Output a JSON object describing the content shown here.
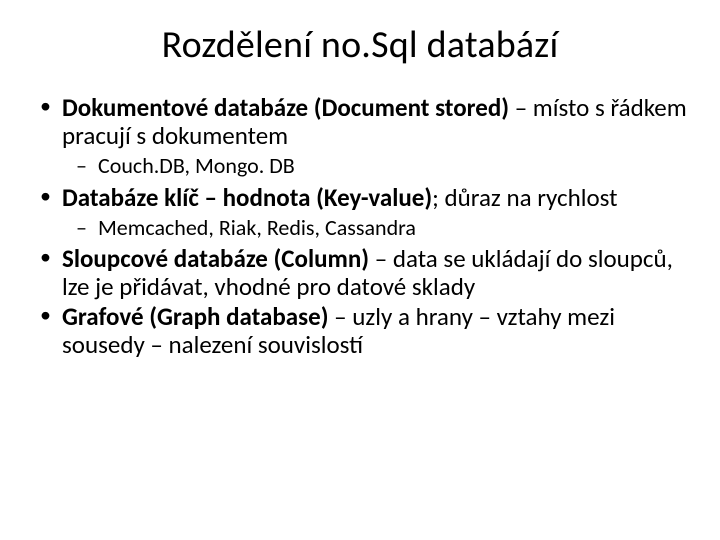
{
  "title": "Rozdělení no.Sql databází",
  "items": [
    {
      "main_bold": "Dokumentové databáze (Document stored)",
      "main_rest": " – místo s řádkem pracují s dokumentem",
      "sub": "Couch.DB, Mongo. DB"
    },
    {
      "main_bold": "Databáze klíč – hodnota (Key-value)",
      "main_rest": "; důraz na rychlost",
      "sub": "Memcached, Riak, Redis, Cassandra"
    },
    {
      "main_bold": "Sloupcové databáze (Column)",
      "main_rest": " – data se ukládají do sloupců, lze je přidávat, vhodné pro datové sklady",
      "sub": null
    },
    {
      "main_bold": "Grafové (Graph database)",
      "main_rest": " – uzly a hrany – vztahy mezi sousedy – nalezení souvislostí",
      "sub": null
    }
  ]
}
